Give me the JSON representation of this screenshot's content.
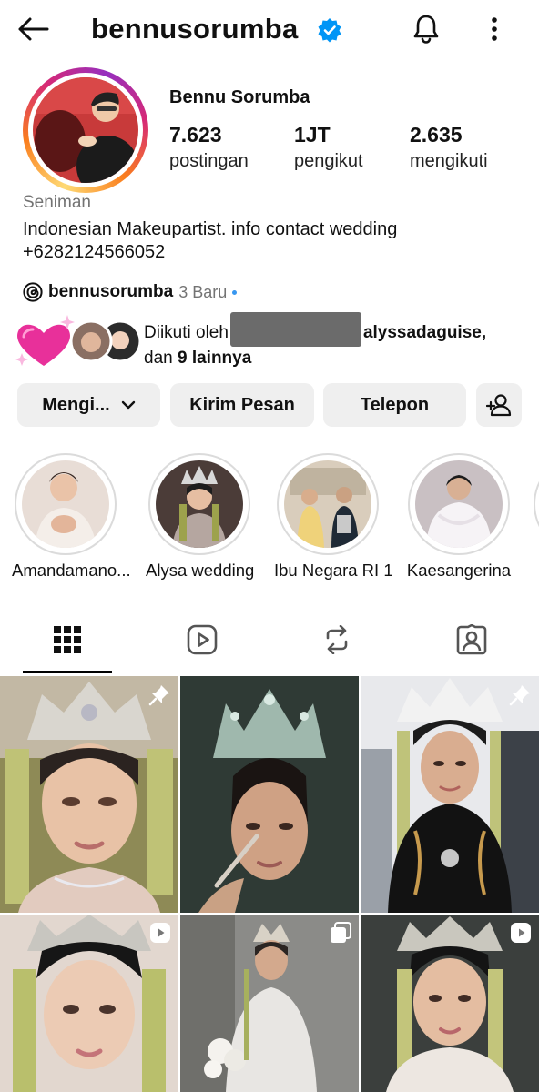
{
  "header": {
    "username": "bennusorumba",
    "icons": {
      "back": "arrow-left-icon",
      "verified": "verified-badge-icon",
      "notifications": "bell-icon",
      "more": "more-vertical-icon"
    }
  },
  "profile": {
    "full_name": "Bennu Sorumba",
    "stats": [
      {
        "value": "7.623",
        "label": "postingan"
      },
      {
        "value": "1JT",
        "label": "pengikut"
      },
      {
        "value": "2.635",
        "label": "mengikuti"
      }
    ],
    "category": "Seniman",
    "bio_line1": "Indonesian Makeupartist.  info contact wedding",
    "bio_line2": "+6282124566052",
    "threads": {
      "handle": "bennusorumba",
      "new_label": "3 Baru"
    },
    "followed_by": {
      "prefix": "Diikuti oleh",
      "name": "alyssadaguise,",
      "suffix_pre": "dan ",
      "suffix_bold": "9 lainnya"
    }
  },
  "actions": {
    "following": "Mengi...",
    "message": "Kirim Pesan",
    "call": "Telepon"
  },
  "highlights": [
    {
      "label": "Amandamano..."
    },
    {
      "label": "Alysa wedding"
    },
    {
      "label": "Ibu Negara RI 1"
    },
    {
      "label": "Kaesangerina"
    }
  ],
  "tabs": [
    {
      "name": "grid-icon",
      "active": true
    },
    {
      "name": "reels-icon",
      "active": false
    },
    {
      "name": "repost-icon",
      "active": false
    },
    {
      "name": "tagged-icon",
      "active": false
    }
  ],
  "colors": {
    "verified": "#0095f6",
    "button_bg": "#efefef",
    "muted": "#737373",
    "accent_dot": "#3897f0"
  }
}
